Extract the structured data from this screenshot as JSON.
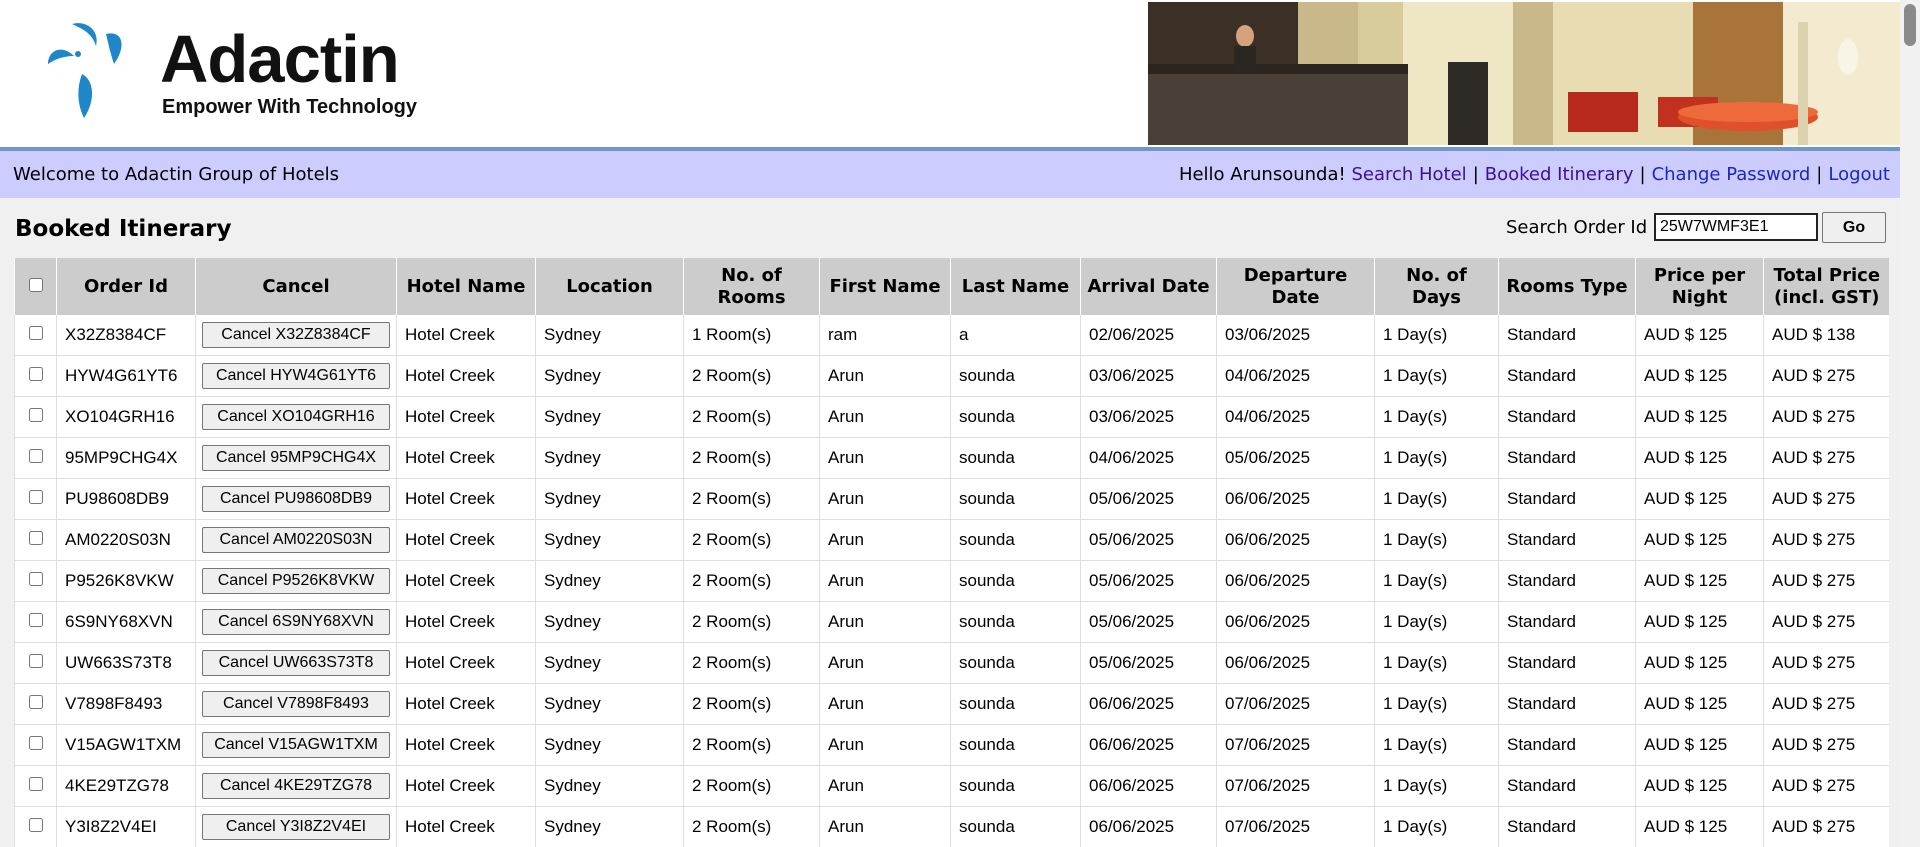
{
  "header": {
    "brand_name": "Adactin",
    "tagline": "Empower With Technology"
  },
  "welcome_bar": {
    "welcome_text": "Welcome to Adactin Group of Hotels",
    "greeting": "Hello Arunsounda!",
    "links": {
      "search_hotel": "Search Hotel",
      "booked_itinerary": "Booked Itinerary",
      "change_password": "Change Password",
      "logout": "Logout"
    },
    "separator": "|"
  },
  "page": {
    "title": "Booked Itinerary",
    "search_label": "Search Order Id",
    "search_value": "25W7WMF3E1",
    "go_label": "Go"
  },
  "table": {
    "headers": {
      "order_id": "Order Id",
      "cancel": "Cancel",
      "hotel_name": "Hotel Name",
      "location": "Location",
      "rooms": "No. of Rooms",
      "first_name": "First Name",
      "last_name": "Last Name",
      "arrival": "Arrival Date",
      "departure": "Departure Date",
      "days": "No. of Days",
      "room_type": "Rooms Type",
      "price_night": "Price per Night",
      "total_price": "Total Price (incl. GST)"
    },
    "rows": [
      {
        "order_id": "X32Z8384CF",
        "cancel": "Cancel X32Z8384CF",
        "hotel": "Hotel Creek",
        "location": "Sydney",
        "rooms": "1 Room(s)",
        "first": "ram",
        "last": "a",
        "arrival": "02/06/2025",
        "departure": "03/06/2025",
        "days": "1 Day(s)",
        "type": "Standard",
        "price": "AUD $ 125",
        "total": "AUD $ 138"
      },
      {
        "order_id": "HYW4G61YT6",
        "cancel": "Cancel HYW4G61YT6",
        "hotel": "Hotel Creek",
        "location": "Sydney",
        "rooms": "2 Room(s)",
        "first": "Arun",
        "last": "sounda",
        "arrival": "03/06/2025",
        "departure": "04/06/2025",
        "days": "1 Day(s)",
        "type": "Standard",
        "price": "AUD $ 125",
        "total": "AUD $ 275"
      },
      {
        "order_id": "XO104GRH16",
        "cancel": "Cancel XO104GRH16",
        "hotel": "Hotel Creek",
        "location": "Sydney",
        "rooms": "2 Room(s)",
        "first": "Arun",
        "last": "sounda",
        "arrival": "03/06/2025",
        "departure": "04/06/2025",
        "days": "1 Day(s)",
        "type": "Standard",
        "price": "AUD $ 125",
        "total": "AUD $ 275"
      },
      {
        "order_id": "95MP9CHG4X",
        "cancel": "Cancel 95MP9CHG4X",
        "hotel": "Hotel Creek",
        "location": "Sydney",
        "rooms": "2 Room(s)",
        "first": "Arun",
        "last": "sounda",
        "arrival": "04/06/2025",
        "departure": "05/06/2025",
        "days": "1 Day(s)",
        "type": "Standard",
        "price": "AUD $ 125",
        "total": "AUD $ 275"
      },
      {
        "order_id": "PU98608DB9",
        "cancel": "Cancel PU98608DB9",
        "hotel": "Hotel Creek",
        "location": "Sydney",
        "rooms": "2 Room(s)",
        "first": "Arun",
        "last": "sounda",
        "arrival": "05/06/2025",
        "departure": "06/06/2025",
        "days": "1 Day(s)",
        "type": "Standard",
        "price": "AUD $ 125",
        "total": "AUD $ 275"
      },
      {
        "order_id": "AM0220S03N",
        "cancel": "Cancel AM0220S03N",
        "hotel": "Hotel Creek",
        "location": "Sydney",
        "rooms": "2 Room(s)",
        "first": "Arun",
        "last": "sounda",
        "arrival": "05/06/2025",
        "departure": "06/06/2025",
        "days": "1 Day(s)",
        "type": "Standard",
        "price": "AUD $ 125",
        "total": "AUD $ 275"
      },
      {
        "order_id": "P9526K8VKW",
        "cancel": "Cancel P9526K8VKW",
        "hotel": "Hotel Creek",
        "location": "Sydney",
        "rooms": "2 Room(s)",
        "first": "Arun",
        "last": "sounda",
        "arrival": "05/06/2025",
        "departure": "06/06/2025",
        "days": "1 Day(s)",
        "type": "Standard",
        "price": "AUD $ 125",
        "total": "AUD $ 275"
      },
      {
        "order_id": "6S9NY68XVN",
        "cancel": "Cancel 6S9NY68XVN",
        "hotel": "Hotel Creek",
        "location": "Sydney",
        "rooms": "2 Room(s)",
        "first": "Arun",
        "last": "sounda",
        "arrival": "05/06/2025",
        "departure": "06/06/2025",
        "days": "1 Day(s)",
        "type": "Standard",
        "price": "AUD $ 125",
        "total": "AUD $ 275"
      },
      {
        "order_id": "UW663S73T8",
        "cancel": "Cancel UW663S73T8",
        "hotel": "Hotel Creek",
        "location": "Sydney",
        "rooms": "2 Room(s)",
        "first": "Arun",
        "last": "sounda",
        "arrival": "05/06/2025",
        "departure": "06/06/2025",
        "days": "1 Day(s)",
        "type": "Standard",
        "price": "AUD $ 125",
        "total": "AUD $ 275"
      },
      {
        "order_id": "V7898F8493",
        "cancel": "Cancel V7898F8493",
        "hotel": "Hotel Creek",
        "location": "Sydney",
        "rooms": "2 Room(s)",
        "first": "Arun",
        "last": "sounda",
        "arrival": "06/06/2025",
        "departure": "07/06/2025",
        "days": "1 Day(s)",
        "type": "Standard",
        "price": "AUD $ 125",
        "total": "AUD $ 275"
      },
      {
        "order_id": "V15AGW1TXM",
        "cancel": "Cancel V15AGW1TXM",
        "hotel": "Hotel Creek",
        "location": "Sydney",
        "rooms": "2 Room(s)",
        "first": "Arun",
        "last": "sounda",
        "arrival": "06/06/2025",
        "departure": "07/06/2025",
        "days": "1 Day(s)",
        "type": "Standard",
        "price": "AUD $ 125",
        "total": "AUD $ 275"
      },
      {
        "order_id": "4KE29TZG78",
        "cancel": "Cancel 4KE29TZG78",
        "hotel": "Hotel Creek",
        "location": "Sydney",
        "rooms": "2 Room(s)",
        "first": "Arun",
        "last": "sounda",
        "arrival": "06/06/2025",
        "departure": "07/06/2025",
        "days": "1 Day(s)",
        "type": "Standard",
        "price": "AUD $ 125",
        "total": "AUD $ 275"
      },
      {
        "order_id": "Y3I8Z2V4EI",
        "cancel": "Cancel Y3I8Z2V4EI",
        "hotel": "Hotel Creek",
        "location": "Sydney",
        "rooms": "2 Room(s)",
        "first": "Arun",
        "last": "sounda",
        "arrival": "06/06/2025",
        "departure": "07/06/2025",
        "days": "1 Day(s)",
        "type": "Standard",
        "price": "AUD $ 125",
        "total": "AUD $ 275"
      }
    ]
  },
  "colors": {
    "header_accent": "#6f98c8",
    "welcome_bar_bg": "#ccccff",
    "table_header_bg": "#cccccc",
    "logo_blue": "#1f86c8"
  }
}
